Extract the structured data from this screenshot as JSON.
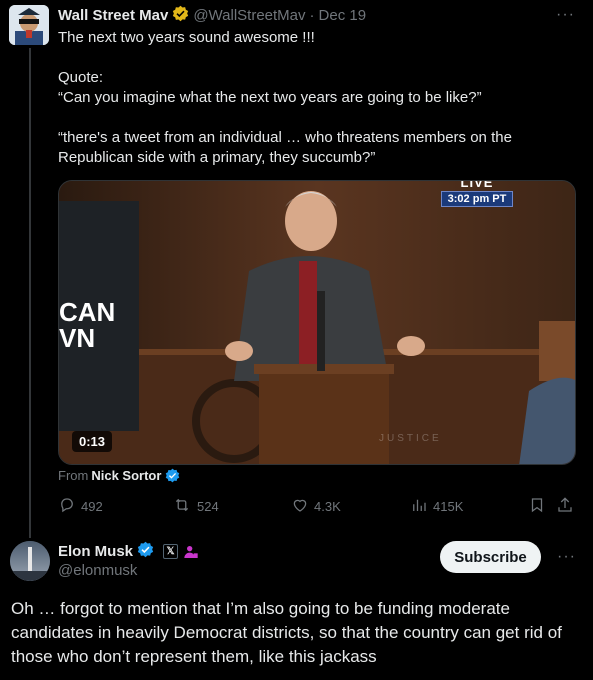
{
  "quoted_tweet": {
    "author_name": "Wall Street Mav",
    "author_handle": "@WallStreetMav",
    "separator": "·",
    "date": "Dec 19",
    "text_line1": "The next two years sound awesome !!!",
    "text_quote_label": "Quote:",
    "text_quote1": "“Can you imagine what the next two years are going to be like?”",
    "text_quote2": "“there's a tweet from an individual … who threatens members on the Republican side with a primary, they succumb?”",
    "more_icon": "more-horizontal-icon",
    "video": {
      "duration": "0:13",
      "live_label": "LIVE",
      "live_time": "3:02 pm PT",
      "banner_line1": "CAN",
      "banner_line2": "VN",
      "watermark": "JUSTICE"
    },
    "from_label": "From",
    "from_name": "Nick Sortor",
    "actions": {
      "replies": "492",
      "reposts": "524",
      "likes": "4.3K",
      "views": "415K"
    }
  },
  "main_tweet": {
    "author_name": "Elon Musk",
    "author_handle": "@elonmusk",
    "subscribe_label": "Subscribe",
    "x_badge": "𝕏",
    "text": "Oh … forgot to mention that I’m also going to be funding moderate candidates in heavily Democrat districts, so that the country can get rid of those who don’t represent them, like this jackass"
  },
  "colors": {
    "background": "#000000",
    "text": "#e7e9ea",
    "muted": "#71767b",
    "verified_gold": "#e2b719",
    "verified_blue": "#1d9bf0",
    "gov_purple": "#c936cc"
  }
}
